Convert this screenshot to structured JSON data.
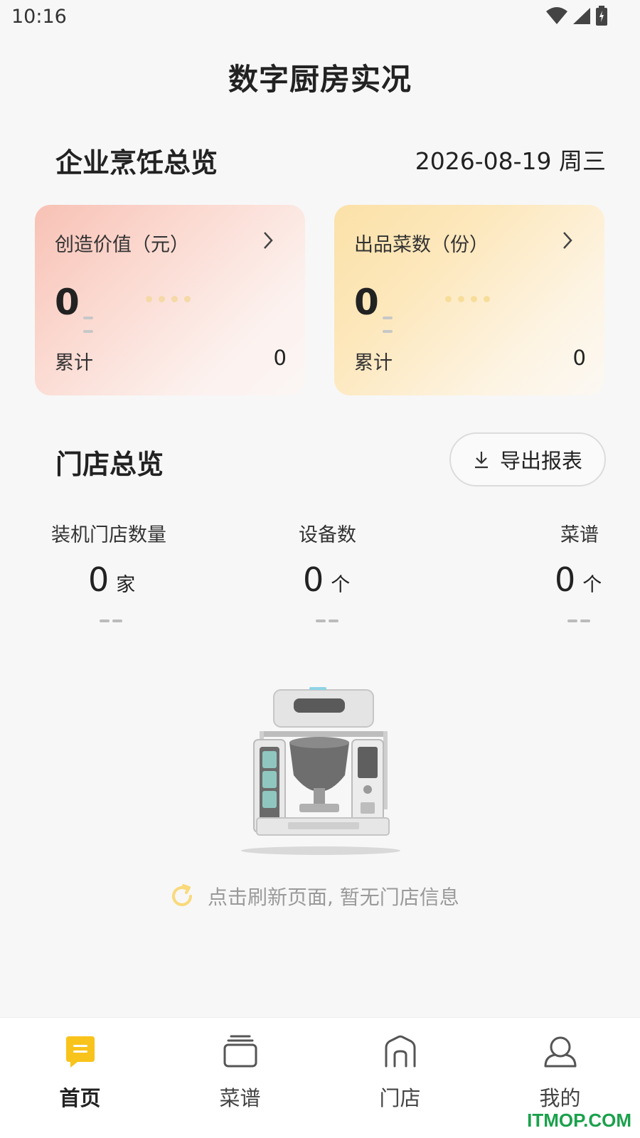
{
  "status_bar": {
    "time": "10:16"
  },
  "page_title": "数字厨房实况",
  "enterprise": {
    "title": "企业烹饪总览",
    "date": "2026-08-19 周三",
    "cards": [
      {
        "label": "创造价值（元）",
        "value": "0",
        "cumulative_label": "累计",
        "cumulative_value": "0"
      },
      {
        "label": "出品菜数（份）",
        "value": "0",
        "cumulative_label": "累计",
        "cumulative_value": "0"
      }
    ]
  },
  "store_overview": {
    "title": "门店总览",
    "export_label": "导出报表",
    "metrics": [
      {
        "label": "装机门店数量",
        "value": "0",
        "unit": "家"
      },
      {
        "label": "设备数",
        "value": "0",
        "unit": "个"
      },
      {
        "label": "菜谱",
        "value": "0",
        "unit": "个"
      }
    ]
  },
  "empty_state": {
    "text": "点击刷新页面, 暂无门店信息"
  },
  "tab_bar": {
    "items": [
      {
        "label": "首页",
        "icon": "home-icon",
        "active": true
      },
      {
        "label": "菜谱",
        "icon": "recipe-icon",
        "active": false
      },
      {
        "label": "门店",
        "icon": "store-icon",
        "active": false
      },
      {
        "label": "我的",
        "icon": "profile-icon",
        "active": false
      }
    ]
  },
  "watermark": "ITMOP.COM",
  "colors": {
    "accent": "#f8c31b",
    "card_value": "#f8c1b5",
    "card_dishes": "#fbe1a8",
    "refresh": "#f9d97a"
  }
}
